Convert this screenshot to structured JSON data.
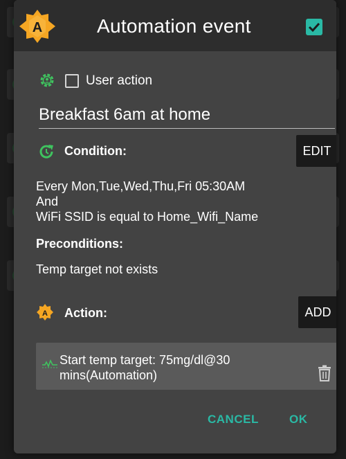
{
  "dialog": {
    "title": "Automation event",
    "enabled": true
  },
  "user_action": {
    "label": "User action",
    "checked": false
  },
  "event_title": "Breakfast 6am at home",
  "condition": {
    "label": "Condition:",
    "edit_label": "EDIT",
    "lines": [
      "Every Mon,Tue,Wed,Thu,Fri 05:30AM",
      "And",
      "WiFi SSID is equal to Home_Wifi_Name"
    ]
  },
  "preconditions": {
    "label": "Preconditions:",
    "text": "Temp target not exists"
  },
  "action": {
    "label": "Action:",
    "add_label": "ADD",
    "items": [
      {
        "text": "Start temp target: 75mg/dl@30 mins(Automation)"
      }
    ]
  },
  "footer": {
    "cancel_label": "CANCEL",
    "ok_label": "OK"
  },
  "colors": {
    "accent": "#2ab9a5",
    "logo_orange": "#f5a623",
    "icon_green": "#3fc35f"
  }
}
